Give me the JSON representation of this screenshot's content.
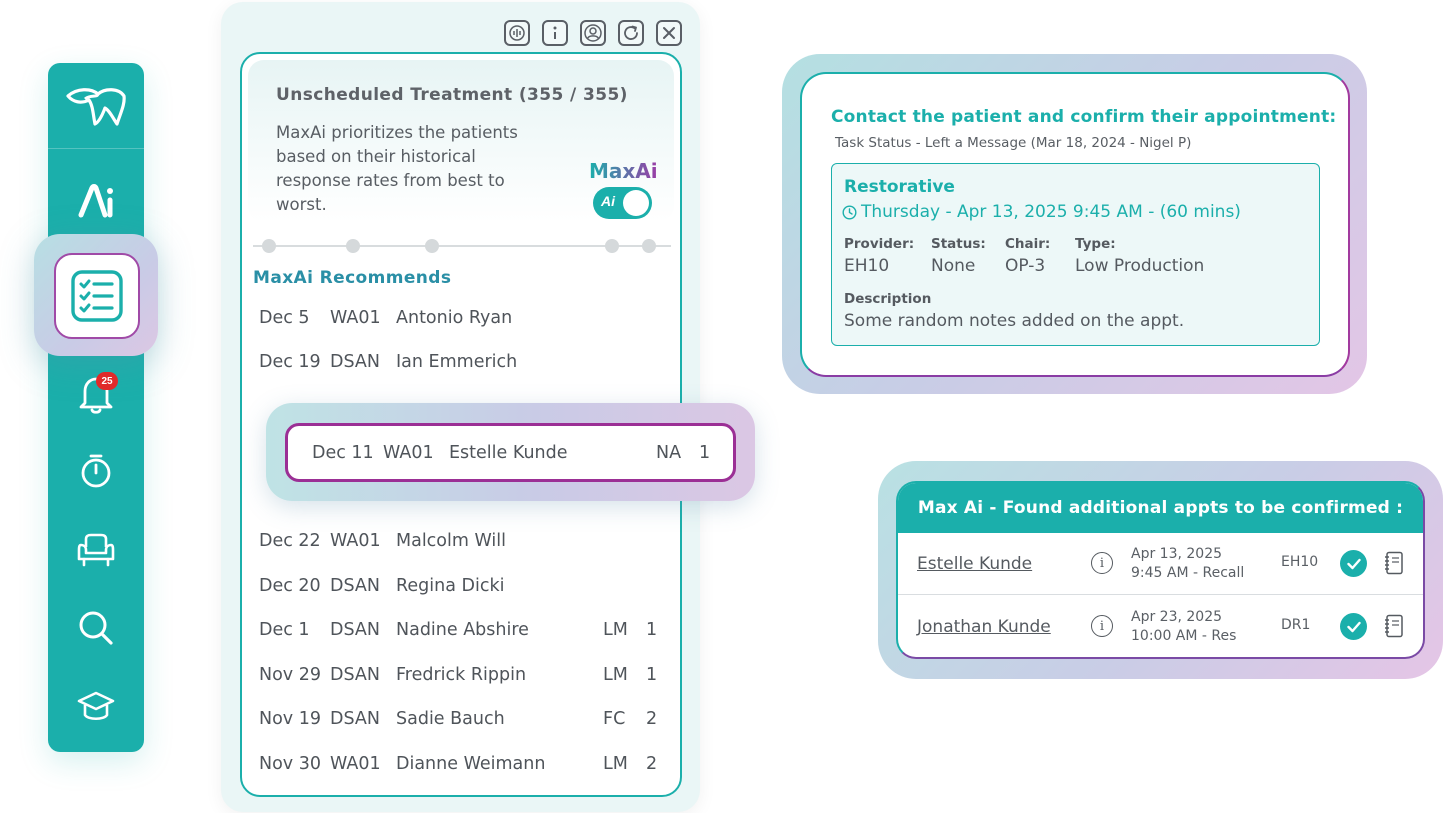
{
  "sidebar": {
    "items": [
      {
        "name": "logo",
        "icon": "tooth-logo-icon"
      },
      {
        "name": "maxai",
        "icon": "ai-icon"
      },
      {
        "name": "tasks",
        "icon": "checklist-icon",
        "active": true
      },
      {
        "name": "notifications",
        "icon": "bell-icon",
        "badge": "25"
      },
      {
        "name": "timer",
        "icon": "stopwatch-icon"
      },
      {
        "name": "chair",
        "icon": "chair-icon"
      },
      {
        "name": "search",
        "icon": "search-icon"
      },
      {
        "name": "education",
        "icon": "graduation-cap-icon"
      }
    ],
    "badge": "25",
    "accent_color": "#1bafab"
  },
  "panel": {
    "toolbar": [
      "voice-icon",
      "info-icon",
      "user-icon",
      "refresh-icon",
      "close-icon"
    ],
    "title": "Unscheduled Treatment (355 / 355)",
    "description": "MaxAi prioritizes the patients based on their historical response rates from best to worst.",
    "maxai_label": "MaxAi",
    "maxai_toggle_icon": "Ai",
    "recommends_label": "MaxAi Recommends",
    "rows_top": [
      {
        "date": "Dec 5",
        "code": "WA01",
        "name": "Antonio Ryan",
        "status": "",
        "count": ""
      },
      {
        "date": "Dec 19",
        "code": "DSAN",
        "name": "Ian Emmerich",
        "status": "",
        "count": ""
      }
    ],
    "highlighted": {
      "date": "Dec 11",
      "code": "WA01",
      "name": "Estelle Kunde",
      "status": "NA",
      "count": "1"
    },
    "rows_bottom": [
      {
        "date": "Dec 22",
        "code": "WA01",
        "name": "Malcolm Will",
        "status": "",
        "count": ""
      },
      {
        "date": "Dec 20",
        "code": "DSAN",
        "name": "Regina Dicki",
        "status": "",
        "count": ""
      },
      {
        "date": "Dec 1",
        "code": "DSAN",
        "name": "Nadine Abshire",
        "status": "LM",
        "count": "1"
      },
      {
        "date": "Nov 29",
        "code": "DSAN",
        "name": "Fredrick Rippin",
        "status": "LM",
        "count": "1"
      },
      {
        "date": "Nov 19",
        "code": "DSAN",
        "name": "Sadie Bauch",
        "status": "FC",
        "count": "2"
      },
      {
        "date": "Nov 30",
        "code": "WA01",
        "name": "Dianne Weimann",
        "status": "LM",
        "count": "2"
      }
    ]
  },
  "contact": {
    "title": "Contact the patient and confirm their appointment:",
    "task_status": "Task Status - Left a Message (Mar 18, 2024 - Nigel P)",
    "appt_type": "Restorative",
    "appt_when": "Thursday - Apr 13, 2025 9:45 AM - (60 mins)",
    "fields": [
      {
        "label": "Provider:",
        "value": "EH10"
      },
      {
        "label": "Status:",
        "value": "None"
      },
      {
        "label": "Chair:",
        "value": "OP-3"
      },
      {
        "label": "Type:",
        "value": "Low Production"
      }
    ],
    "description_label": "Description",
    "description": "Some random notes added on the appt."
  },
  "additional": {
    "title": "Max Ai - Found additional appts to be confirmed :",
    "rows": [
      {
        "name": "Estelle Kunde",
        "date": "Apr 13, 2025",
        "time": "9:45 AM - Recall",
        "provider": "EH10"
      },
      {
        "name": "Jonathan Kunde",
        "date": "Apr 23, 2025",
        "time": "10:00 AM - Res",
        "provider": "DR1"
      }
    ]
  }
}
